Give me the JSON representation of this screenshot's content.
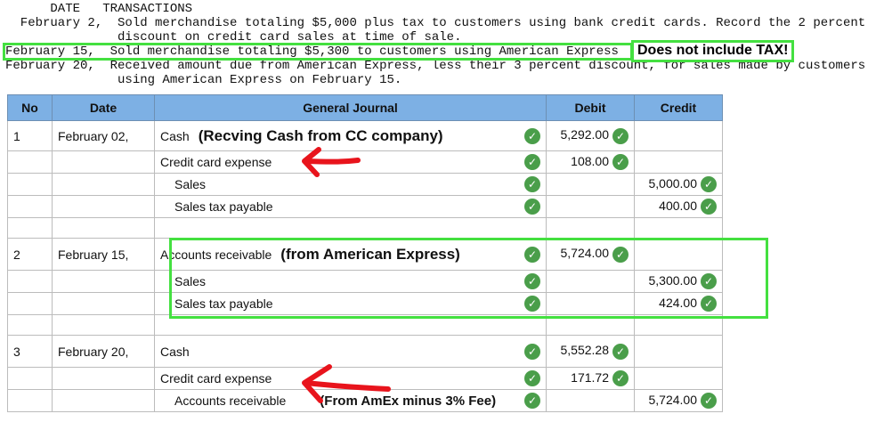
{
  "transactions": {
    "header": "      DATE   TRANSACTIONS",
    "lines": [
      "  February 2,  Sold merchandise totaling $5,000 plus tax to customers using bank credit cards. Record the 2 percent",
      "               discount on credit card sales at time of sale.",
      "February 15,  Sold merchandise totaling $5,300 to customers using American Express",
      "February 20,  Received amount due from American Express, less their 3 percent discount, for sales made by customers",
      "               using American Express on February 15."
    ],
    "note": "Does not include TAX!"
  },
  "journal": {
    "headers": [
      "No",
      "Date",
      "General Journal",
      "Debit",
      "Credit"
    ],
    "entries": [
      {
        "no": "1",
        "date": "February 02,",
        "rows": [
          {
            "account": "Cash",
            "indent": false,
            "debit": "5,292.00",
            "credit": "",
            "annotation": "(Recving Cash from CC company)"
          },
          {
            "account": "Credit card expense",
            "indent": false,
            "debit": "108.00",
            "credit": "",
            "annotation": ""
          },
          {
            "account": "Sales",
            "indent": true,
            "debit": "",
            "credit": "5,000.00",
            "annotation": ""
          },
          {
            "account": "Sales tax payable",
            "indent": true,
            "debit": "",
            "credit": "400.00",
            "annotation": ""
          }
        ]
      },
      {
        "no": "2",
        "date": "February 15,",
        "rows": [
          {
            "account": "Accounts receivable",
            "indent": false,
            "debit": "5,724.00",
            "credit": "",
            "annotation": "(from American Express)"
          },
          {
            "account": "Sales",
            "indent": true,
            "debit": "",
            "credit": "5,300.00",
            "annotation": ""
          },
          {
            "account": "Sales tax payable",
            "indent": true,
            "debit": "",
            "credit": "424.00",
            "annotation": ""
          }
        ]
      },
      {
        "no": "3",
        "date": "February 20,",
        "rows": [
          {
            "account": "Cash",
            "indent": false,
            "debit": "5,552.28",
            "credit": "",
            "annotation": ""
          },
          {
            "account": "Credit card expense",
            "indent": false,
            "debit": "171.72",
            "credit": "",
            "annotation": ""
          },
          {
            "account": "Accounts receivable",
            "indent": true,
            "debit": "",
            "credit": "5,724.00",
            "annotation": "(From  AmEx minus 3% Fee)"
          }
        ]
      }
    ]
  },
  "colors": {
    "header_bg": "#7db0e4",
    "check": "#4a9e4a",
    "highlight": "#44e040",
    "arrow": "#e8141c"
  }
}
